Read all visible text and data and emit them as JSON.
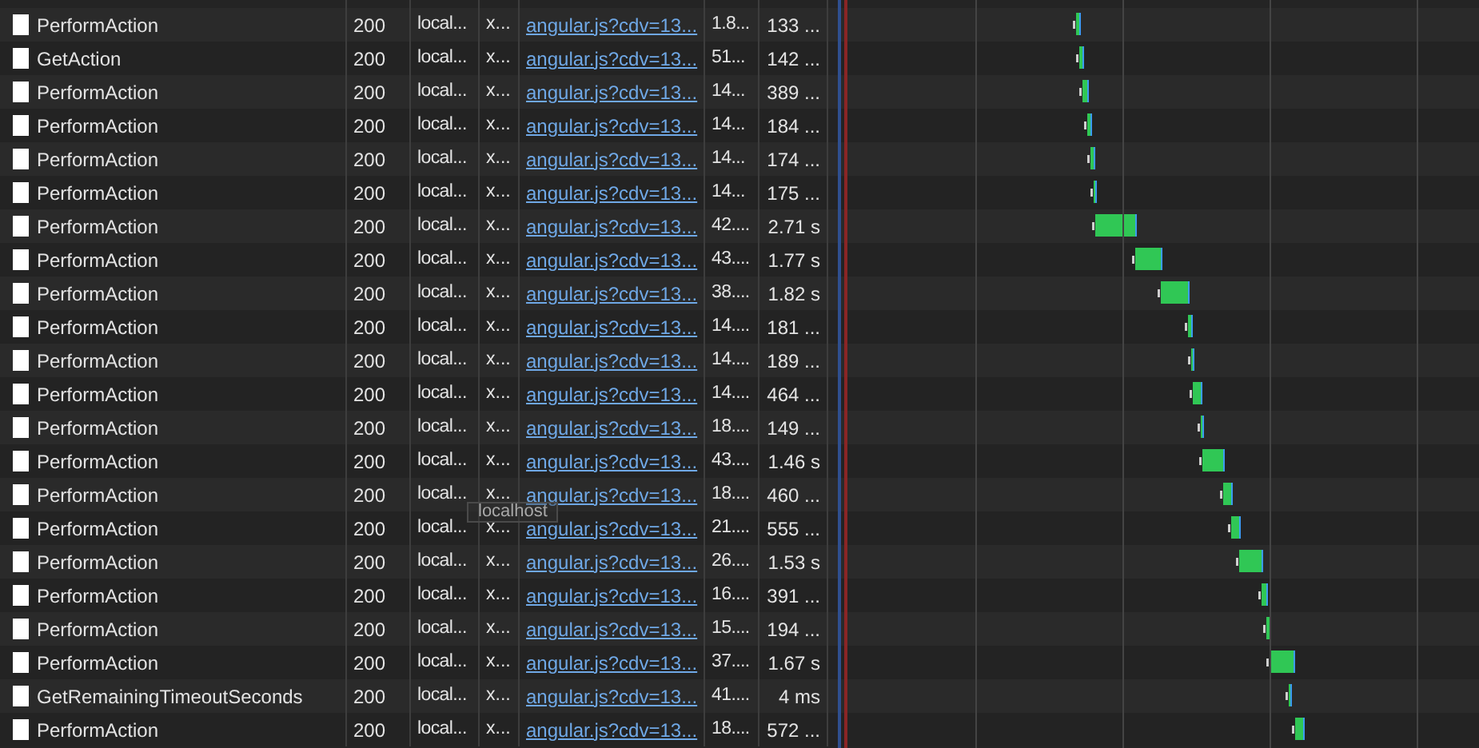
{
  "requests": [
    {
      "name": "PerformAction",
      "status": "200",
      "domain": "local...",
      "type": "x...",
      "initiator": "angular.js?cdv=13...",
      "size": "1.8...",
      "time": "133 ..."
    },
    {
      "name": "GetAction",
      "status": "200",
      "domain": "local...",
      "type": "x...",
      "initiator": "angular.js?cdv=13...",
      "size": "51...",
      "time": "142 ..."
    },
    {
      "name": "PerformAction",
      "status": "200",
      "domain": "local...",
      "type": "x...",
      "initiator": "angular.js?cdv=13...",
      "size": "14...",
      "time": "389 ..."
    },
    {
      "name": "PerformAction",
      "status": "200",
      "domain": "local...",
      "type": "x...",
      "initiator": "angular.js?cdv=13...",
      "size": "14...",
      "time": "184 ..."
    },
    {
      "name": "PerformAction",
      "status": "200",
      "domain": "local...",
      "type": "x...",
      "initiator": "angular.js?cdv=13...",
      "size": "14...",
      "time": "174 ..."
    },
    {
      "name": "PerformAction",
      "status": "200",
      "domain": "local...",
      "type": "x...",
      "initiator": "angular.js?cdv=13...",
      "size": "14...",
      "time": "175 ..."
    },
    {
      "name": "PerformAction",
      "status": "200",
      "domain": "local...",
      "type": "x...",
      "initiator": "angular.js?cdv=13...",
      "size": "42....",
      "time": "2.71 s"
    },
    {
      "name": "PerformAction",
      "status": "200",
      "domain": "local...",
      "type": "x...",
      "initiator": "angular.js?cdv=13...",
      "size": "43....",
      "time": "1.77 s"
    },
    {
      "name": "PerformAction",
      "status": "200",
      "domain": "local...",
      "type": "x...",
      "initiator": "angular.js?cdv=13...",
      "size": "38....",
      "time": "1.82 s"
    },
    {
      "name": "PerformAction",
      "status": "200",
      "domain": "local...",
      "type": "x...",
      "initiator": "angular.js?cdv=13...",
      "size": "14....",
      "time": "181 ..."
    },
    {
      "name": "PerformAction",
      "status": "200",
      "domain": "local...",
      "type": "x...",
      "initiator": "angular.js?cdv=13...",
      "size": "14....",
      "time": "189 ..."
    },
    {
      "name": "PerformAction",
      "status": "200",
      "domain": "local...",
      "type": "x...",
      "initiator": "angular.js?cdv=13...",
      "size": "14....",
      "time": "464 ..."
    },
    {
      "name": "PerformAction",
      "status": "200",
      "domain": "local...",
      "type": "x...",
      "initiator": "angular.js?cdv=13...",
      "size": "18....",
      "time": "149 ..."
    },
    {
      "name": "PerformAction",
      "status": "200",
      "domain": "local...",
      "type": "x...",
      "initiator": "angular.js?cdv=13...",
      "size": "43....",
      "time": "1.46 s"
    },
    {
      "name": "PerformAction",
      "status": "200",
      "domain": "local...",
      "type": "x...",
      "initiator": "angular.js?cdv=13...",
      "size": "18....",
      "time": "460 ..."
    },
    {
      "name": "PerformAction",
      "status": "200",
      "domain": "local...",
      "type": "x...",
      "initiator": "angular.js?cdv=13...",
      "size": "21....",
      "time": "555 ..."
    },
    {
      "name": "PerformAction",
      "status": "200",
      "domain": "local...",
      "type": "x...",
      "initiator": "angular.js?cdv=13...",
      "size": "26....",
      "time": "1.53 s"
    },
    {
      "name": "PerformAction",
      "status": "200",
      "domain": "local...",
      "type": "x...",
      "initiator": "angular.js?cdv=13...",
      "size": "16....",
      "time": "391 ..."
    },
    {
      "name": "PerformAction",
      "status": "200",
      "domain": "local...",
      "type": "x...",
      "initiator": "angular.js?cdv=13...",
      "size": "15....",
      "time": "194 ..."
    },
    {
      "name": "PerformAction",
      "status": "200",
      "domain": "local...",
      "type": "x...",
      "initiator": "angular.js?cdv=13...",
      "size": "37....",
      "time": "1.67 s"
    },
    {
      "name": "GetRemainingTimeoutSeconds",
      "status": "200",
      "domain": "local...",
      "type": "x...",
      "initiator": "angular.js?cdv=13...",
      "size": "41....",
      "time": "4 ms"
    },
    {
      "name": "PerformAction",
      "status": "200",
      "domain": "local...",
      "type": "x...",
      "initiator": "angular.js?cdv=13...",
      "size": "18....",
      "time": "572 ..."
    }
  ],
  "tooltip": {
    "text": "localhost"
  }
}
